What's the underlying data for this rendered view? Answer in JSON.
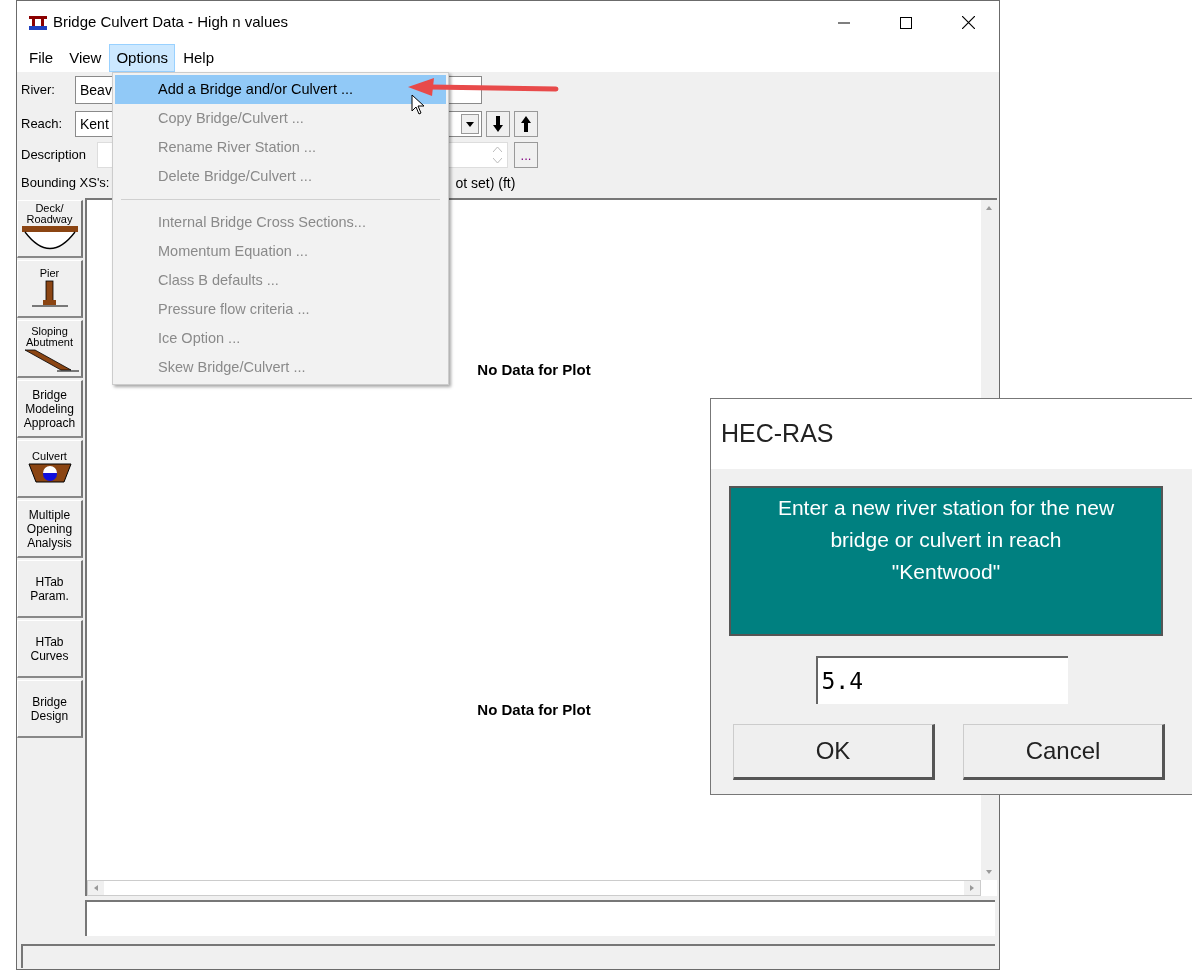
{
  "window": {
    "title": "Bridge Culvert Data - High n values"
  },
  "menu": [
    {
      "label": "File",
      "selected": false
    },
    {
      "label": "View",
      "selected": false
    },
    {
      "label": "Options",
      "selected": true
    },
    {
      "label": "Help",
      "selected": false
    }
  ],
  "options_menu": {
    "groups": [
      [
        {
          "label": "Add a Bridge and/or Culvert ...",
          "disabled": false,
          "selected": true
        },
        {
          "label": "Copy Bridge/Culvert ...",
          "disabled": true,
          "selected": false
        },
        {
          "label": "Rename River Station ...",
          "disabled": true,
          "selected": false
        },
        {
          "label": "Delete Bridge/Culvert ...",
          "disabled": true,
          "selected": false
        }
      ],
      [
        {
          "label": "Internal Bridge Cross Sections...",
          "disabled": true,
          "selected": false
        },
        {
          "label": "Momentum Equation ...",
          "disabled": true,
          "selected": false
        },
        {
          "label": "Class B defaults ...",
          "disabled": true,
          "selected": false
        },
        {
          "label": "Pressure flow criteria ...",
          "disabled": true,
          "selected": false
        },
        {
          "label": "Ice Option ...",
          "disabled": true,
          "selected": false
        },
        {
          "label": "Skew Bridge/Culvert ...",
          "disabled": true,
          "selected": false
        }
      ]
    ]
  },
  "river": {
    "label": "River:",
    "value": "Beav"
  },
  "reach": {
    "label": "Reach:",
    "value": "Kent"
  },
  "description": {
    "label": "Description",
    "button": "..."
  },
  "bounding": {
    "label": "Bounding XS's:",
    "tail": "ot set) (ft)"
  },
  "side_tabs": [
    {
      "label": "Deck/\nRoadway",
      "kind": "deck"
    },
    {
      "label": "Pier",
      "kind": "pier"
    },
    {
      "label": "Sloping\nAbutment",
      "kind": "abutment"
    },
    {
      "label": "Bridge\nModeling\nApproach",
      "kind": "text"
    },
    {
      "label": "Culvert",
      "kind": "culvert"
    },
    {
      "label": "Multiple\nOpening\nAnalysis",
      "kind": "text"
    },
    {
      "label": "HTab\nParam.",
      "kind": "text"
    },
    {
      "label": "HTab\nCurves",
      "kind": "text"
    },
    {
      "label": "Bridge\nDesign",
      "kind": "text"
    }
  ],
  "plot_messages": [
    "No Data for Plot",
    "No Data for Plot"
  ],
  "dialog": {
    "title": "HEC-RAS",
    "message": "Enter a new river station for the new bridge or culvert in reach \"Kentwood\"",
    "value": "5.4",
    "buttons": [
      "OK",
      "Cancel"
    ]
  }
}
